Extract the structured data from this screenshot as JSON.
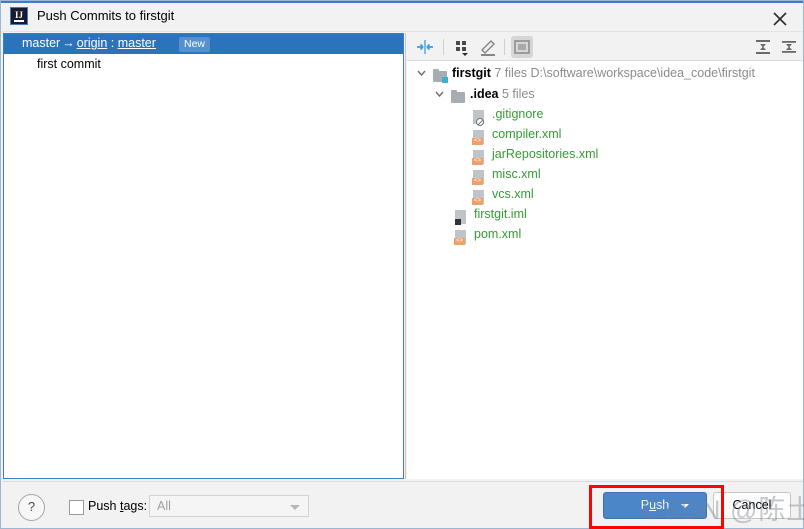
{
  "window": {
    "title": "Push Commits to firstgit",
    "app_icon": "intellij-idea-icon",
    "close_icon": "close-icon",
    "accent_color": "#3d7cc9"
  },
  "commits_panel": {
    "branch": {
      "local": "master",
      "arrow": "→",
      "remote_name": "origin",
      "separator": ":",
      "remote_branch": "master",
      "badge": "New"
    },
    "commits": [
      {
        "message": "first commit"
      }
    ]
  },
  "tree_toolbar": {
    "buttons": [
      {
        "name": "expand-selection-icon",
        "label": ""
      },
      {
        "name": "group-by-icon",
        "label": ""
      },
      {
        "name": "edit-icon",
        "label": ""
      },
      {
        "name": "preview-diff-icon",
        "label": "",
        "pressed": true
      },
      {
        "name": "expand-all-icon",
        "label": ""
      },
      {
        "name": "collapse-all-icon",
        "label": ""
      }
    ]
  },
  "file_tree": {
    "nodes": [
      {
        "name": "firstgit",
        "count": "7 files",
        "path": "D:\\software\\workspace\\idea_code\\firstgit",
        "icon": "folder-vcs-icon",
        "type": "dir",
        "expanded": true,
        "depth": 0
      },
      {
        "name": ".idea",
        "count": "5 files",
        "path": "",
        "icon": "folder-icon",
        "type": "dir",
        "expanded": true,
        "depth": 1
      },
      {
        "name": ".gitignore",
        "count": "",
        "path": "",
        "icon": "gitignore-file-icon",
        "type": "file",
        "depth": 2
      },
      {
        "name": "compiler.xml",
        "count": "",
        "path": "",
        "icon": "xml-file-icon",
        "type": "file",
        "depth": 2
      },
      {
        "name": "jarRepositories.xml",
        "count": "",
        "path": "",
        "icon": "xml-file-icon",
        "type": "file",
        "depth": 2
      },
      {
        "name": "misc.xml",
        "count": "",
        "path": "",
        "icon": "xml-file-icon",
        "type": "file",
        "depth": 2
      },
      {
        "name": "vcs.xml",
        "count": "",
        "path": "",
        "icon": "xml-file-icon",
        "type": "file",
        "depth": 2
      },
      {
        "name": "firstgit.iml",
        "count": "",
        "path": "",
        "icon": "iml-file-icon",
        "type": "file",
        "depth": 1
      },
      {
        "name": "pom.xml",
        "count": "",
        "path": "",
        "icon": "xml-file-icon",
        "type": "file",
        "depth": 1
      }
    ]
  },
  "footer": {
    "help_label": "?",
    "push_tags_label_pre": "Push ",
    "push_tags_mnemonic": "t",
    "push_tags_label_post": "ags:",
    "push_tags_checked": false,
    "tags_value": "All",
    "push_label_pre": "P",
    "push_mnemonic": "u",
    "push_label_post": "sh",
    "cancel_label": "Cancel"
  },
  "annotation": {
    "rect_color": "#fb0404",
    "watermark": "CSDN @陈土人 ~"
  }
}
